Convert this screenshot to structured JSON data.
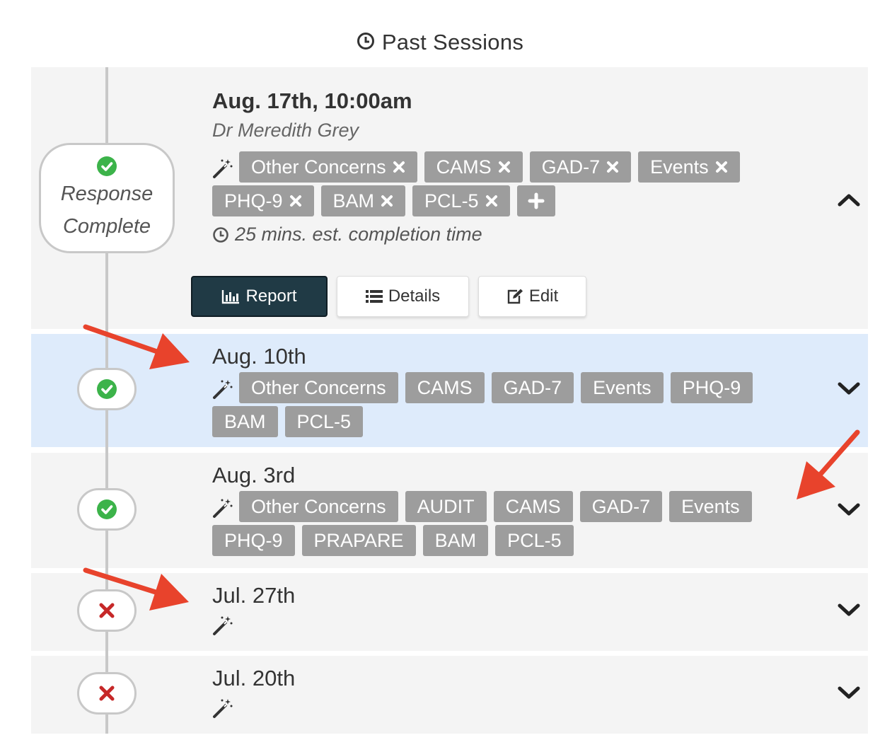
{
  "header": {
    "title": "Past Sessions",
    "icon": "clock-icon"
  },
  "colors": {
    "success": "#3cb34a",
    "danger": "#c62828",
    "tag": "#9d9d9d",
    "highlight": "#deebfb",
    "dark_button": "#203a45",
    "annotation_arrow": "#e8432c"
  },
  "sessions": [
    {
      "date": "Aug. 17th, 10:00am",
      "clinician": "Dr Meredith Grey",
      "status_line1": "Response",
      "status_line2": "Complete",
      "tags": [
        "Other Concerns",
        "CAMS",
        "GAD-7",
        "Events",
        "PHQ-9",
        "BAM",
        "PCL-5"
      ],
      "est_time": "25 mins. est. completion time",
      "buttons": {
        "report": "Report",
        "details": "Details",
        "edit": "Edit"
      },
      "expanded": true
    },
    {
      "date": "Aug. 10th",
      "tags": [
        "Other Concerns",
        "CAMS",
        "GAD-7",
        "Events",
        "PHQ-9",
        "BAM",
        "PCL-5"
      ],
      "status": "complete"
    },
    {
      "date": "Aug. 3rd",
      "tags": [
        "Other Concerns",
        "AUDIT",
        "CAMS",
        "GAD-7",
        "Events",
        "PHQ-9",
        "PRAPARE",
        "BAM",
        "PCL-5"
      ],
      "status": "complete"
    },
    {
      "date": "Jul. 27th",
      "tags": [],
      "status": "incomplete"
    },
    {
      "date": "Jul. 20th",
      "tags": [],
      "status": "incomplete"
    }
  ]
}
